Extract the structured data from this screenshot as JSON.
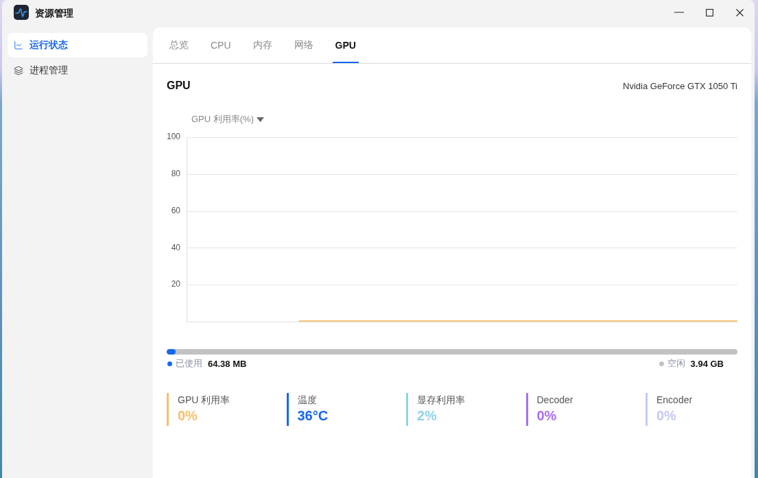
{
  "window": {
    "title": "资源管理"
  },
  "sidebar": {
    "items": [
      {
        "label": "运行状态",
        "selected": true
      },
      {
        "label": "进程管理",
        "selected": false
      }
    ]
  },
  "tabs": [
    {
      "label": "总览",
      "selected": false
    },
    {
      "label": "CPU",
      "selected": false
    },
    {
      "label": "内存",
      "selected": false
    },
    {
      "label": "网络",
      "selected": false
    },
    {
      "label": "GPU",
      "selected": true
    }
  ],
  "gpu_panel": {
    "title": "GPU",
    "device": "Nvidia GeForce GTX 1050 Ti",
    "chart_data": {
      "type": "line",
      "grid": true,
      "ylim": [
        0,
        100
      ],
      "yticks": [
        20,
        40,
        60,
        80,
        100
      ],
      "categories": [
        null,
        null,
        null,
        null,
        null,
        null,
        null,
        null,
        null,
        null,
        null,
        null,
        null,
        null,
        null,
        null,
        null,
        null,
        null,
        null,
        null,
        null,
        null,
        null,
        null,
        null,
        null,
        null,
        null,
        null,
        null,
        null,
        null,
        null,
        null,
        null,
        null,
        null,
        null,
        null,
        null,
        null,
        null,
        null,
        null,
        null,
        null,
        null,
        null,
        null
      ],
      "series": [
        {
          "name": "GPU 利用率(%)",
          "color": "#f6c97c",
          "values": [
            null,
            null,
            null,
            null,
            null,
            null,
            null,
            null,
            null,
            null,
            0,
            0,
            0,
            0,
            0,
            0,
            0,
            0,
            0,
            0,
            0,
            0,
            0,
            0,
            0,
            0,
            0,
            0,
            0,
            0,
            0,
            0,
            0,
            0,
            0,
            0,
            0,
            0,
            0,
            0,
            0,
            0,
            0,
            0,
            0,
            0,
            0,
            0,
            0,
            0
          ]
        }
      ]
    },
    "memory": {
      "level": 0.016,
      "legend": [
        {
          "label": "已使用",
          "value": "64.38 MB",
          "color": "#1668f0"
        },
        {
          "label": "空闲",
          "value": "3.94 GB",
          "color": "#c2c2c2"
        }
      ]
    },
    "stats": [
      {
        "label": "GPU 利用率",
        "value": "0%",
        "color": "#f7be6a"
      },
      {
        "label": "温度",
        "value": "36°C",
        "color": "#1668f0"
      },
      {
        "label": "显存利用率",
        "value": "2%",
        "color": "#8fd3ea"
      },
      {
        "label": "Decoder",
        "value": "0%",
        "color": "#a96ef6"
      },
      {
        "label": "Encoder",
        "value": "0%",
        "color": "#c3c8f6"
      }
    ]
  }
}
